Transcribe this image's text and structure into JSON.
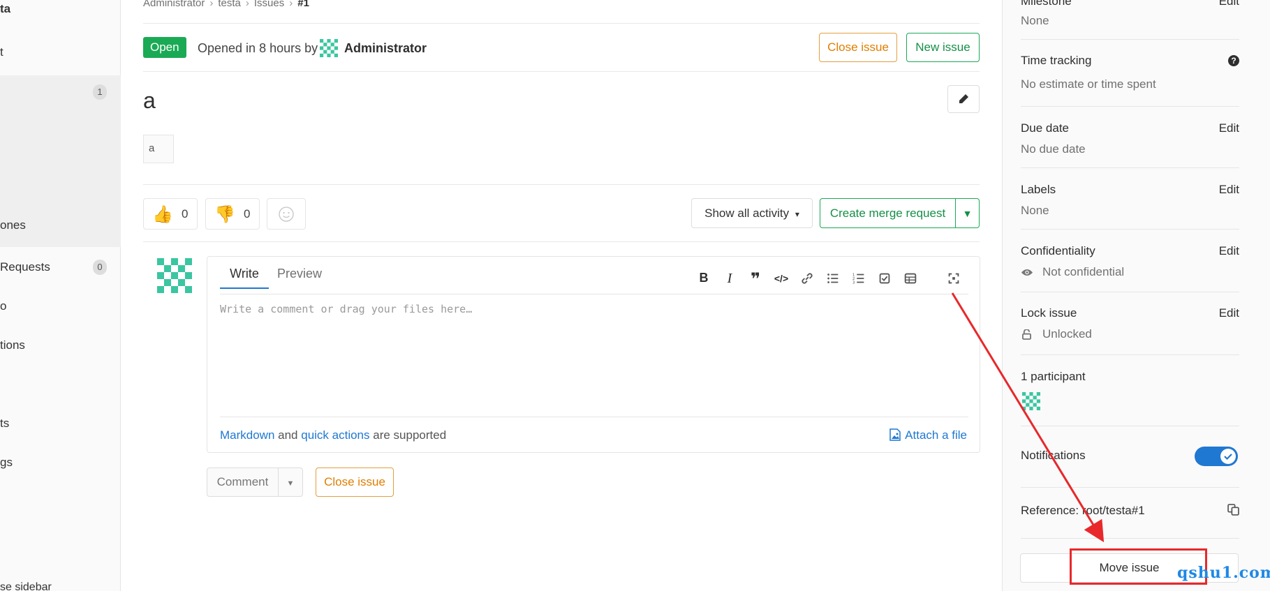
{
  "left_sidebar": {
    "project_fragment": "ta",
    "item_fragment_1": "t",
    "issues_count": "1",
    "milestones_fragment": "ones",
    "merge_requests_fragment": " Requests",
    "merge_requests_count": "0",
    "wiki_fragment": "o",
    "operations_fragment": "tions",
    "snippets_fragment": "ts",
    "settings_fragment": "gs",
    "collapse_fragment": "se sidebar"
  },
  "breadcrumb": {
    "items": [
      "Administrator",
      "testa",
      "Issues",
      "#1"
    ]
  },
  "header": {
    "status": "Open",
    "opened_text": "Opened in 8 hours by",
    "author": "Administrator",
    "close_issue": "Close issue",
    "new_issue": "New issue"
  },
  "issue": {
    "title": "a",
    "broken_image_alt": "a"
  },
  "awards": {
    "thumbsup_count": "0",
    "thumbsdown_count": "0"
  },
  "activity": {
    "filter": "Show all activity",
    "create_merge_request": "Create merge request"
  },
  "comment": {
    "tab_write": "Write",
    "tab_preview": "Preview",
    "placeholder": "Write a comment or drag your files here…",
    "footer_markdown": "Markdown",
    "footer_and": " and ",
    "footer_quick_actions": "quick actions",
    "footer_supported": " are supported",
    "attach_file": "Attach a file",
    "comment_button": "Comment",
    "close_issue_button": "Close issue"
  },
  "right_sidebar": {
    "milestone": {
      "title": "Milestone",
      "edit": "Edit",
      "value": "None"
    },
    "time_tracking": {
      "title": "Time tracking",
      "value": "No estimate or time spent"
    },
    "due_date": {
      "title": "Due date",
      "edit": "Edit",
      "value": "No due date"
    },
    "labels": {
      "title": "Labels",
      "edit": "Edit",
      "value": "None"
    },
    "confidentiality": {
      "title": "Confidentiality",
      "edit": "Edit",
      "value": "Not confidential"
    },
    "lock_issue": {
      "title": "Lock issue",
      "edit": "Edit",
      "value": "Unlocked"
    },
    "participants": {
      "title": "1 participant"
    },
    "notifications": {
      "title": "Notifications",
      "enabled": true
    },
    "reference": {
      "text": "Reference: root/testa#1"
    },
    "move_issue": "Move issue"
  },
  "watermark": "qshu1.com",
  "colors": {
    "open_badge": "#1aaa55",
    "warning": "#e07e00",
    "success": "#168f48",
    "link": "#1f78d1",
    "annotation_red": "#e8282b"
  }
}
